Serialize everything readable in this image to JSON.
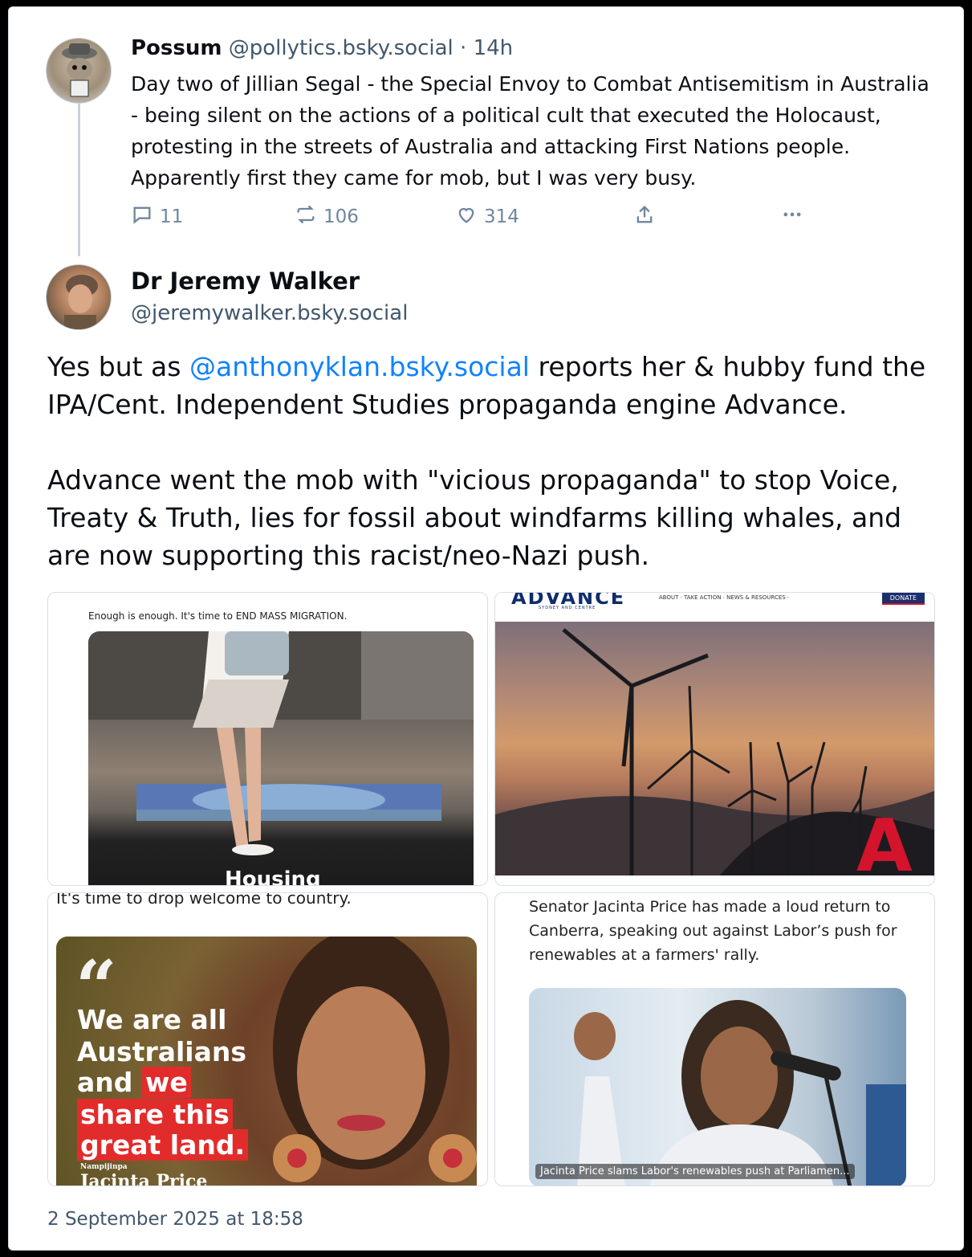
{
  "parent_post": {
    "author_name": "Possum",
    "author_handle": "@pollytics.bsky.social",
    "time_sep": "·",
    "age": "14h",
    "text": "Day two of Jillian Segal - the Special Envoy to Combat Antisemitism in Australia - being silent on the actions of a political cult that executed the Holocaust, protesting in the streets of Australia and attacking First Nations people. Apparently first they came for mob, but I was very busy.",
    "counts": {
      "replies": "11",
      "reposts": "106",
      "likes": "314"
    },
    "icons": [
      "reply-icon",
      "repost-icon",
      "like-icon",
      "share-icon",
      "more-icon"
    ]
  },
  "reply_post": {
    "author_name": "Dr Jeremy Walker",
    "author_handle": "@jeremywalker.bsky.social",
    "text_before_mention": "Yes but as ",
    "mention": "@anthonyklan.bsky.social",
    "text_after_mention": " reports her & hubby fund the IPA/Cent. Independent Studies propaganda engine Advance.\n\nAdvance went the mob with \"vicious propaganda\" to stop Voice, Treaty & Truth, lies for fossil about windfarms killing whales, and are now supporting this racist/neo-Nazi push.",
    "timestamp": "2 September 2025 at 18:58",
    "colors": {
      "mention": "#1083fe",
      "muted": "#42576c",
      "accent_red": "#e22b2b"
    }
  },
  "images": {
    "img1": {
      "caption": "Enough is enough. It's time to END MASS MIGRATION.",
      "overlay": "Housing"
    },
    "img2": {
      "logo": "ADVANCE",
      "logo_sub": "SYDNEY AND CENTRE",
      "nav": "ABOUT ·   TAKE ACTION ·   NEWS & RESOURCES ·",
      "button": "DONATE",
      "mark": "A"
    },
    "img3": {
      "caption": "It's time to drop welcome to country.",
      "quote_mark": "“",
      "quote_lines": [
        "We are all",
        "Australians",
        "and",
        "we",
        "share this",
        "great land."
      ],
      "signature_small": "Nampijinpa",
      "signature": "Jacinta Price"
    },
    "img4": {
      "caption": "Senator Jacinta Price has made a loud return to Canberra, speaking out against Labor’s push for renewables at a farmers' rally.",
      "overlay": "Jacinta Price slams Labor's renewables push at Parliamen..."
    }
  }
}
